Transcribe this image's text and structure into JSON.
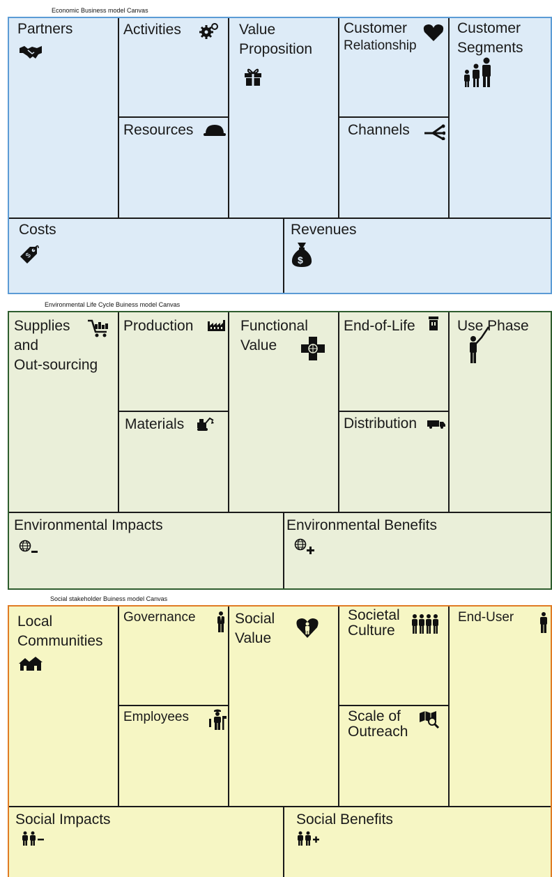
{
  "economic": {
    "title": "Economic Business model Canvas",
    "partners": "Partners",
    "activities": "Activities",
    "resources": "Resources",
    "value_line1": "Value",
    "value_line2": "Proposition",
    "relationship_line1": "Customer",
    "relationship_line2": "Relationship",
    "channels": "Channels",
    "segments_line1": "Customer",
    "segments_line2": "Segments",
    "costs": "Costs",
    "revenues": "Revenues"
  },
  "environmental": {
    "title": "Environmental Life Cycle Buiness model Canvas",
    "supplies_line1": "Supplies",
    "supplies_line2": "and",
    "supplies_line3": "Out-sourcing",
    "production": "Production",
    "materials": "Materials",
    "functional_line1": "Functional",
    "functional_line2": "Value",
    "end_of_life": "End-of-Life",
    "distribution": "Distribution",
    "use_phase": "Use Phase",
    "impacts": "Environmental Impacts",
    "benefits": "Environmental Benefits"
  },
  "social": {
    "title": "Social stakeholder Buiness model Canvas",
    "local_line1": "Local",
    "local_line2": "Communities",
    "governance": "Governance",
    "employees": "Employees",
    "value_line1": "Social",
    "value_line2": "Value",
    "culture_line1": "Societal",
    "culture_line2": "Culture",
    "outreach_line1": "Scale of",
    "outreach_line2": "Outreach",
    "end_user": "End-User",
    "impacts": "Social Impacts",
    "benefits": "Social Benefits"
  },
  "icons": {
    "partners": "handshake-icon",
    "activities": "gears-icon",
    "resources": "hard-hat-icon",
    "value": "gift-icon",
    "relationship": "heart-icon",
    "channels": "channels-icon",
    "segments": "family-icon",
    "costs": "price-tag-icon",
    "revenues": "money-bag-icon",
    "supplies": "shopping-cart-icon",
    "production": "factory-icon",
    "materials": "excavator-icon",
    "functional": "medical-cross-icon",
    "end_of_life": "trash-bin-icon",
    "distribution": "truck-icon",
    "use_phase": "person-pointing-icon",
    "env_impacts": "globe-minus-icon",
    "env_benefits": "globe-plus-icon",
    "local": "houses-icon",
    "governance": "businessman-icon",
    "employees": "worker-icon",
    "social_value": "heart-person-icon",
    "culture": "crowd-icon",
    "outreach": "map-search-icon",
    "end_user": "person-icon",
    "soc_impacts": "people-minus-icon",
    "soc_benefits": "people-plus-icon"
  },
  "colors": {
    "economic_fill": "#ddebf7",
    "economic_border": "#5b9bd5",
    "environmental_fill": "#eaefd9",
    "environmental_border": "#2e5d2e",
    "social_fill": "#f6f6c4",
    "social_border": "#e07b24"
  }
}
